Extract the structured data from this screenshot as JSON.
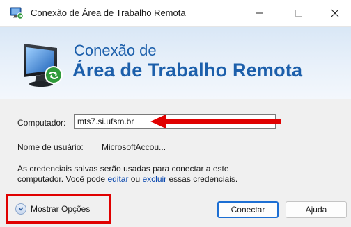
{
  "window": {
    "title": "Conexão de Área de Trabalho Remota",
    "minimize_glyph": "—",
    "maximize_glyph": "☐",
    "close_glyph": "✕"
  },
  "banner": {
    "line1": "Conexão de",
    "line2": "Área de Trabalho Remota"
  },
  "form": {
    "computer_label": "Computador:",
    "computer_value": "mts7.si.ufsm.br",
    "username_label": "Nome de usuário:",
    "username_value": "MicrosoftAccou..."
  },
  "credentials": {
    "text_part1": "As credenciais salvas serão usadas para conectar a este computador. Você pode ",
    "edit_link": "editar",
    "text_part2": " ou ",
    "delete_link": "excluir",
    "text_part3": " essas credenciais."
  },
  "footer": {
    "show_options_label": "Mostrar Opções",
    "connect_label": "Conectar",
    "help_label": "Ajuda"
  },
  "colors": {
    "accent": "#1c5fab",
    "annotation": "#e00000",
    "link": "#0645ad"
  },
  "icons": {
    "title": "remote-desktop-icon",
    "banner": "remote-desktop-monitor-icon",
    "options": "chevron-down-circle-icon",
    "annotation_arrow": "red-arrow-icon"
  }
}
